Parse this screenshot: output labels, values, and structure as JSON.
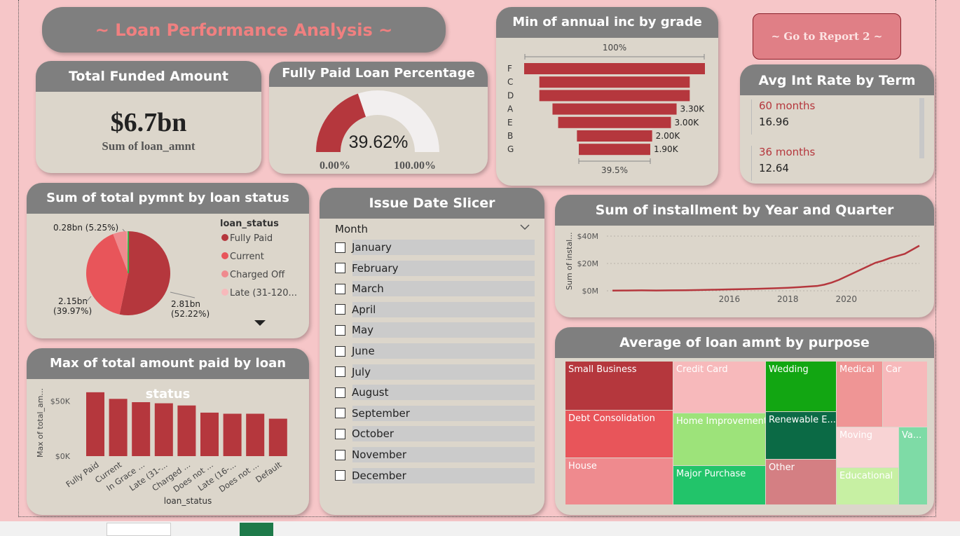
{
  "header": {
    "title": "~ Loan Performance Analysis ~",
    "nav_button": "~ Go to Report 2 ~"
  },
  "kpi": {
    "title": "Total Funded Amount",
    "value": "$6.7bn",
    "subtitle": "Sum of loan_amnt"
  },
  "gauge": {
    "title": "Fully Paid Loan Percentage",
    "value_label": "39.62%",
    "value": 0.3962,
    "min_label": "0.00%",
    "max_label": "100.00%",
    "fill": "#b5373d",
    "track": "#f2efef"
  },
  "funnel": {
    "title": "Min of annual inc by grade",
    "top_pct": "100%",
    "bottom_pct": "39.5%",
    "chart_data": {
      "type": "bar",
      "categories": [
        "F",
        "C",
        "D",
        "A",
        "E",
        "B",
        "G"
      ],
      "values": [
        4808,
        4000,
        4000,
        3300,
        3000,
        2000,
        1900
      ],
      "data_labels": [
        "",
        "",
        "",
        "3.30K",
        "3.00K",
        "2.00K",
        "1.90K"
      ]
    }
  },
  "avg_int": {
    "title": "Avg Int Rate by Term",
    "rows": [
      {
        "term": "60 months",
        "rate": "16.96"
      },
      {
        "term": "36 months",
        "rate": "12.64"
      }
    ]
  },
  "pie": {
    "title": "Sum of total pymnt by loan status",
    "legend_title": "loan_status",
    "chart_data": {
      "type": "pie",
      "labels": [
        "Fully Paid",
        "Current",
        "Charged Off",
        "Late (31-120..."
      ],
      "values": [
        2.81,
        2.15,
        0.28,
        0.03
      ],
      "percents": [
        52.22,
        39.97,
        5.25,
        0.56
      ],
      "colors": [
        "#b5373d",
        "#e8555a",
        "#ef8a8e",
        "#f7b9bb"
      ],
      "extra_color": "#3cb44b"
    },
    "label_a": "0.28bn (5.25%)",
    "label_b1": "2.15bn",
    "label_b2": "(39.97%)",
    "label_c1": "2.81bn",
    "label_c2": "(52.22%)"
  },
  "slicer": {
    "title": "Issue Date Slicer",
    "field": "Month",
    "items": [
      "January",
      "February",
      "March",
      "April",
      "May",
      "June",
      "July",
      "August",
      "September",
      "October",
      "November",
      "December"
    ]
  },
  "line": {
    "title": "Sum of installment by Year and Quarter",
    "ylabel": "Sum of instal...",
    "chart_data": {
      "type": "line",
      "x": [
        2012.0,
        2012.5,
        2013.0,
        2013.5,
        2014.0,
        2014.5,
        2015.0,
        2015.5,
        2016.0,
        2016.5,
        2017.0,
        2017.5,
        2018.0,
        2018.5,
        2019.0,
        2019.25,
        2019.5,
        2019.75,
        2020.0,
        2020.25,
        2020.5,
        2020.75,
        2021.0,
        2021.25,
        2021.5,
        2021.75,
        2022.0,
        2022.25,
        2022.5
      ],
      "y": [
        0.1,
        0.2,
        0.3,
        0.2,
        0.3,
        0.4,
        0.6,
        0.8,
        1.0,
        1.2,
        1.5,
        1.8,
        2.2,
        2.8,
        3.5,
        4.5,
        6.0,
        8.0,
        10.5,
        13.0,
        15.5,
        18.0,
        20.5,
        22.0,
        24.0,
        25.5,
        27.0,
        30.0,
        33.0
      ],
      "yticks": [
        "$0M",
        "$20M",
        "$40M"
      ],
      "xticks": [
        "2016",
        "2018",
        "2020"
      ],
      "ylim": [
        0,
        40
      ]
    }
  },
  "bars": {
    "title": "Max of total amount paid by loan status",
    "ylabel": "Max of total_am...",
    "xlabel": "loan_status",
    "chart_data": {
      "type": "bar",
      "categories": [
        "Fully Paid",
        "Current",
        "In Grace ...",
        "Late (31-...",
        "Charged ...",
        "Does not ...",
        "Late (16-...",
        "Does not ...",
        "Default"
      ],
      "values": [
        58000,
        52000,
        49000,
        48000,
        46000,
        39500,
        38500,
        38500,
        34000
      ],
      "yticks": [
        "$0K",
        "$50K"
      ],
      "ylim": [
        0,
        70000
      ]
    }
  },
  "treemap": {
    "title": "Average of loan amnt by purpose",
    "chart_data": {
      "type": "treemap",
      "labels": [
        "Small Business",
        "Debt Consolidation",
        "House",
        "Credit Card",
        "Home Improvement",
        "Major Purchase",
        "Wedding",
        "Renewable E...",
        "Other",
        "Medical",
        "Car",
        "Moving",
        "Va...",
        "Educational"
      ],
      "colors": [
        "#b5373d",
        "#e8555a",
        "#ef8a8e",
        "#f7b9bb",
        "#9de37a",
        "#22c46a",
        "#12a612",
        "#0b6a45",
        "#d47f83",
        "#ef9595",
        "#f7b9bb",
        "#f8d3d4",
        "#7edba6",
        "#c7f0a3"
      ]
    }
  }
}
